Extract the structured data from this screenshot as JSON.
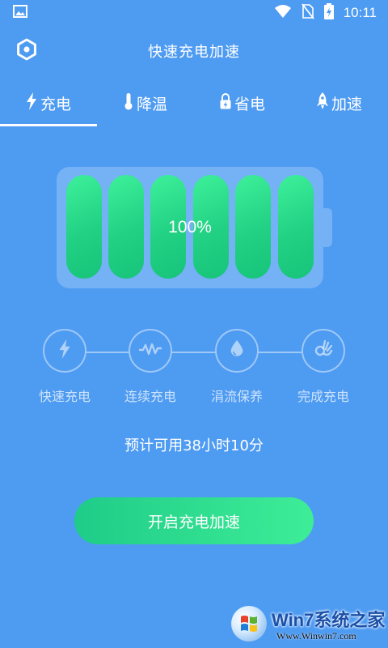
{
  "status_bar": {
    "time": "10:11",
    "icons": [
      "image-notification-icon",
      "wifi-icon",
      "no-sim-icon",
      "battery-charging-icon"
    ]
  },
  "header": {
    "title": "快速充电加速",
    "settings_icon": "settings-icon"
  },
  "tabs": [
    {
      "label": "充电",
      "icon": "bolt-icon",
      "active": true
    },
    {
      "label": "降温",
      "icon": "thermometer-icon",
      "active": false
    },
    {
      "label": "省电",
      "icon": "lock-bolt-icon",
      "active": false
    },
    {
      "label": "加速",
      "icon": "rocket-icon",
      "active": false
    }
  ],
  "battery": {
    "level_percent": 100,
    "level_text": "100%",
    "cells_filled": 6,
    "cells_total": 6
  },
  "charge_stages": [
    {
      "label": "快速充电",
      "icon": "bolt-icon"
    },
    {
      "label": "连续充电",
      "icon": "pulse-icon"
    },
    {
      "label": "涓流保养",
      "icon": "droplet-icon"
    },
    {
      "label": "完成充电",
      "icon": "ok-hand-icon"
    }
  ],
  "estimate_text": "预计可用38小时10分",
  "action_button": {
    "label": "开启充电加速"
  },
  "watermark": {
    "brand": "Win7系统之家",
    "url": "Www.Winwin7.com"
  },
  "colors": {
    "background": "#4e9bf2",
    "battery_cell": "#22d184",
    "button": "#2fdc8f",
    "text": "#ffffff"
  }
}
